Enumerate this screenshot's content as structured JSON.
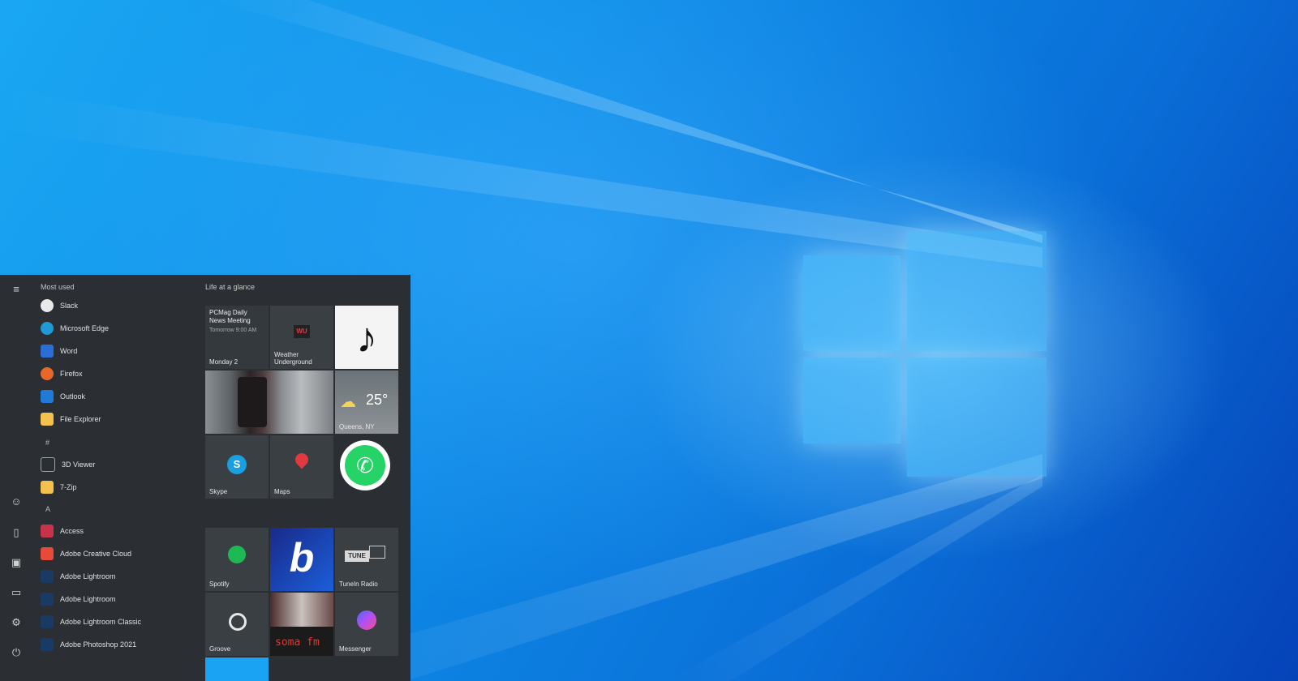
{
  "start_menu": {
    "most_used_title": "Most used",
    "tiles_group_title": "Life at a glance",
    "most_used": [
      {
        "label": "Slack",
        "icon": "slack-icon",
        "color": "#e9e9e9"
      },
      {
        "label": "Microsoft Edge",
        "icon": "edge-icon",
        "color": "#1f9ad6"
      },
      {
        "label": "Word",
        "icon": "word-icon",
        "color": "#2b6fd6"
      },
      {
        "label": "Firefox",
        "icon": "firefox-icon",
        "color": "#e8682b"
      },
      {
        "label": "Outlook",
        "icon": "outlook-icon",
        "color": "#1f7bd6"
      },
      {
        "label": "File Explorer",
        "icon": "folder-icon",
        "color": "#f2c14e"
      }
    ],
    "hash_header": "#",
    "hash_apps": [
      {
        "label": "3D Viewer",
        "icon": "cube-icon",
        "color": "#9aa3aa"
      },
      {
        "label": "7-Zip",
        "icon": "folder-icon",
        "color": "#f2c14e"
      }
    ],
    "a_header": "A",
    "a_apps": [
      {
        "label": "Access",
        "icon": "access-icon",
        "color": "#c8324a"
      },
      {
        "label": "Adobe Creative Cloud",
        "icon": "creative-cloud-icon",
        "color": "#e84a3a"
      },
      {
        "label": "Adobe Lightroom",
        "icon": "lightroom-icon",
        "color": "#1a3a66"
      },
      {
        "label": "Adobe Lightroom",
        "icon": "lightroom-icon",
        "color": "#1a3a66"
      },
      {
        "label": "Adobe Lightroom Classic",
        "icon": "lightroom-icon",
        "color": "#1a3a66"
      },
      {
        "label": "Adobe Photoshop 2021",
        "icon": "photoshop-icon",
        "color": "#1a3a66"
      }
    ],
    "tiles": {
      "calendar_event": "PCMag Daily News Meeting",
      "calendar_time": "Tomorrow 9:00 AM",
      "calendar_day": "Monday 2",
      "weather_underground": "Weather Underground",
      "weather_temp": "25°",
      "weather_location": "Queens, NY",
      "skype": "Skype",
      "maps": "Maps",
      "spotify": "Spotify",
      "tunein": "TuneIn Radio",
      "groove": "Groove",
      "soma_text": "soma fm",
      "messenger": "Messenger",
      "wu_logo": "WU",
      "tunein_logo": "TUNE"
    }
  },
  "colors": {
    "menu_bg": "#2b2f33",
    "tile_bg": "#3a3f44",
    "accent": "#1aa3f2"
  }
}
